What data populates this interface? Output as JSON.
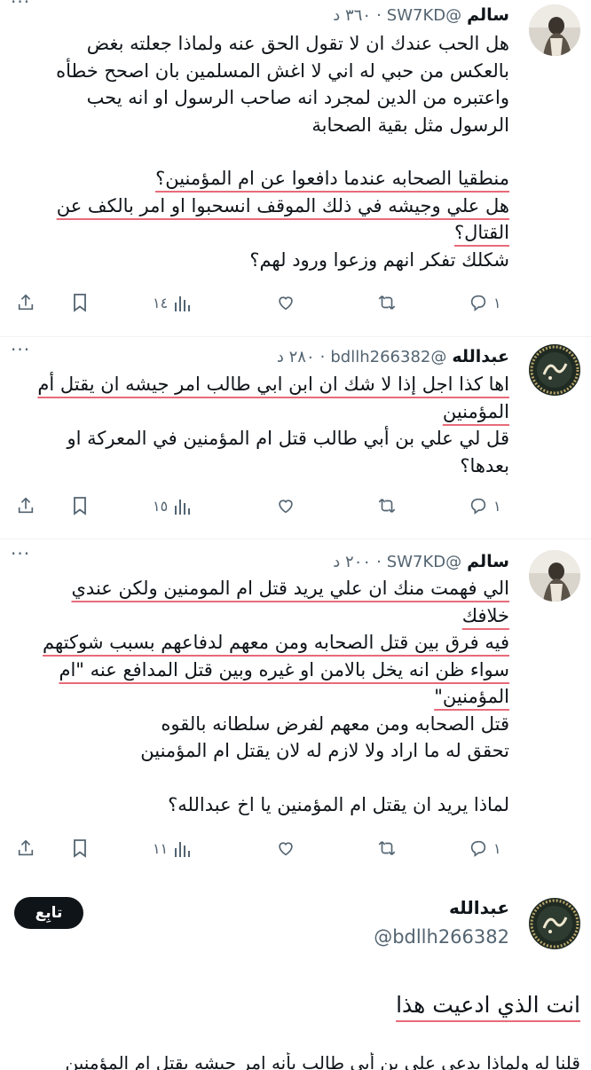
{
  "thread": {
    "tweets": [
      {
        "name": "سالم",
        "handle": "@SW7KD",
        "dot": "·",
        "time": "٣٦٠ د",
        "more": "···",
        "paragraphs": [
          "هل الحب عندك ان لا تقول الحق عنه ولماذا جعلته بغض بالعكس من حبي له اني لا اغش المسلمين بان اصحح خطأه واعتبره من الدين لمجرد انه صاحب الرسول او انه يحب الرسول مثل بقية الصحابة",
          "",
          "منطقيا الصحابه عندما دافعوا عن ام المؤمنين؟",
          "هل علي وجيشه في ذلك الموقف انسحبوا او امر بالكف عن القتال؟",
          "شكلك تفكر انهم وزعوا ورود لهم؟"
        ],
        "replies": "١",
        "views": "١٤"
      },
      {
        "name": "عبدالله",
        "handle": "@bdllh266382",
        "dot": "·",
        "time": "٢٨٠ د",
        "more": "···",
        "paragraphs": [
          "اها كذا اجل إذا لا شك ان ابن ابي طالب امر جيشه ان يقتل أم المؤمنين",
          "قل لي علي بن أبي طالب قتل ام المؤمنين في المعركة او بعدها؟"
        ],
        "replies": "١",
        "views": "١٥"
      },
      {
        "name": "سالم",
        "handle": "@SW7KD",
        "dot": "·",
        "time": "٢٠٠ د",
        "more": "···",
        "paragraphs": [
          "الي فهمت منك ان علي يريد قتل ام المومنين ولكن عندي خلافك",
          "فيه فرق بين قتل الصحابه ومن معهم لدفاعهم بسبب شوكتهم سواء ظن انه يخل بالامن او غيره وبين قتل المدافع عنه \"ام المؤمنين\"",
          "قتل الصحابه ومن معهم لفرض سلطانه بالقوه",
          "تحقق له ما اراد ولا لازم له لان يقتل ام المؤمنين",
          "",
          "لماذا يريد ان يقتل ام المؤمنين يا اخ عبدالله؟"
        ],
        "replies": "١",
        "views": "١١"
      }
    ]
  },
  "post": {
    "name": "عبدالله",
    "handle": "@bdllh266382",
    "follow_label": "تابِع",
    "text": "انت الذي ادعيت هذا",
    "next_line": "قلنا له ولماذا يدعي علي بن أبي طالب بأنه امر جيشه بقتل ام المؤمنين"
  },
  "colors": {
    "underline": "#e76b7a",
    "muted": "#536471",
    "text": "#0f1419"
  }
}
